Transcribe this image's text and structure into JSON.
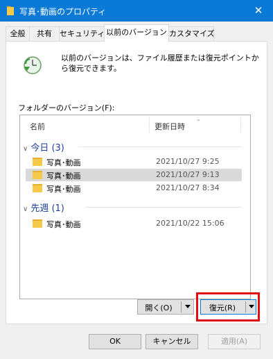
{
  "window": {
    "title": "写真･動画のプロパティ",
    "close_glyph": "✕",
    "accent": "#0b79d6"
  },
  "tabs": [
    {
      "label": "全般"
    },
    {
      "label": "共有"
    },
    {
      "label": "セキュリティ"
    },
    {
      "label": "以前のバージョン",
      "active": true
    },
    {
      "label": "カスタマイズ"
    }
  ],
  "info": {
    "icon": "clock-restore-icon",
    "text": "以前のバージョンは、ファイル履歴または復元ポイントから復元できます。"
  },
  "versions": {
    "label": "フォルダーのバージョン(F):",
    "columns": [
      "名前",
      "更新日時"
    ],
    "groups": [
      {
        "label": "今日 (3)",
        "items": [
          {
            "name": "写真･動画",
            "date": "2021/10/27 9:25",
            "selected": false
          },
          {
            "name": "写真･動画",
            "date": "2021/10/27 9:13",
            "selected": true
          },
          {
            "name": "写真･動画",
            "date": "2021/10/27 8:34",
            "selected": false
          }
        ]
      },
      {
        "label": "先週 (1)",
        "items": [
          {
            "name": "写真･動画",
            "date": "2021/10/22 15:06",
            "selected": false
          }
        ]
      }
    ]
  },
  "buttons": {
    "open": "開く(O)",
    "restore": "復元(R)",
    "ok": "OK",
    "cancel": "キャンセル",
    "apply": "適用(A)"
  },
  "highlight_color": "#e01010"
}
